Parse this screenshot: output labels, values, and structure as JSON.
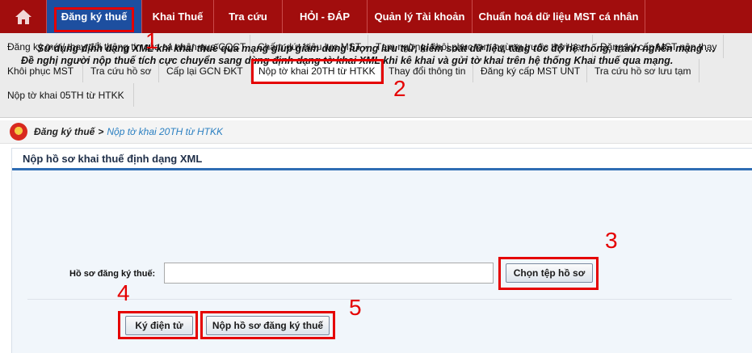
{
  "topnav": {
    "items": [
      {
        "label": "Đăng ký thuế",
        "active": true
      },
      {
        "label": "Khai Thuế"
      },
      {
        "label": "Tra cứu"
      },
      {
        "label": "HỎI - ĐÁP"
      },
      {
        "label": "Quản lý Tài khoản"
      },
      {
        "label": "Chuẩn hoá dữ liệu MST cá nhân"
      }
    ],
    "home_icon": "home-icon"
  },
  "submenu": {
    "row1": [
      "Đăng ký mới/ thay đổi thông tin của cá nhân qua CQCT",
      "Chấm dứt hiệu lực MST",
      "Tạm ngừng/ khôi phục tạm ngừng trước thời hạn",
      "Đăng ký cấp MST nộp thay"
    ],
    "row2": [
      "Khôi phục MST",
      "Tra cứu hồ sơ",
      "Cấp lại GCN ĐKT",
      "Nộp tờ khai 20TH từ HTKK",
      "Thay đổi thông tin",
      "Đăng ký cấp MST UNT",
      "Tra cứu hồ sơ lưu tạm"
    ],
    "row3": [
      "Nộp tờ khai 05TH từ HTKK"
    ]
  },
  "breadcrumb": {
    "root": "Đăng ký thuế",
    "separator": ">",
    "current": "Nộp tờ khai 20TH từ HTKK"
  },
  "form": {
    "title": "Nộp hồ sơ khai thuế định dạng XML",
    "notice": "Sử dụng định dạng XML khi khai thuế qua mạng giúp giảm dung lượng lưu trữ, kiểm soát dữ liệu, tăng tốc độ hệ thống, tránh nghẽn mạng … Đề nghị người nộp thuế tích cực chuyển sang dùng định dạng tờ khai XML khi kê khai và gửi tờ khai trên hệ thống Khai thuế qua mạng.",
    "file_label": "Hồ sơ đăng ký thuế:",
    "file_value": "",
    "choose_button": "Chọn tệp hồ sơ",
    "sign_button": "Ký điện tử",
    "submit_button": "Nộp hồ sơ đăng ký thuế"
  },
  "annotations": [
    "1",
    "2",
    "3",
    "4",
    "5"
  ],
  "colors": {
    "nav_bg": "#a10d0d",
    "nav_active": "#1d4fa0",
    "annotation": "#e50000",
    "breadcrumb_link": "#2a7fc1"
  }
}
